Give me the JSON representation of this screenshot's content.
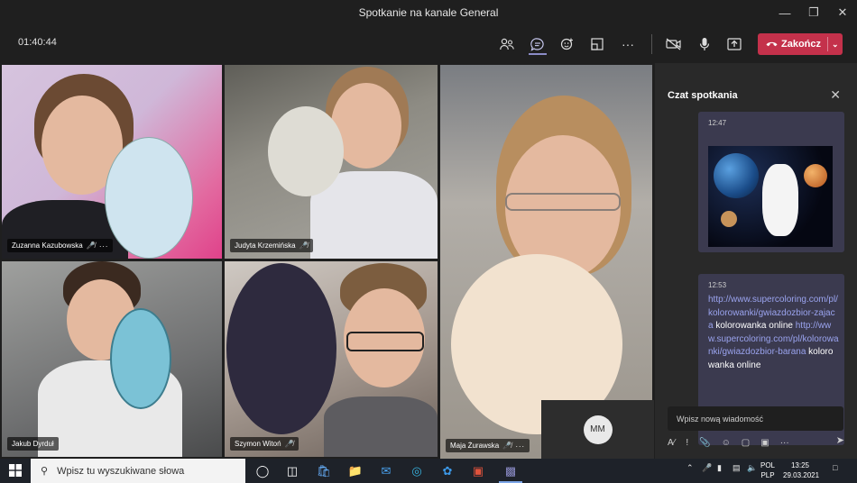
{
  "window": {
    "title": "Spotkanie na kanale General"
  },
  "toolbar": {
    "timer": "01:40:44",
    "end_label": "Zakończ",
    "icons": [
      "participants-icon",
      "chat-icon",
      "reactions-icon",
      "share-tray-icon",
      "more-icon",
      "camera-off-icon",
      "mic-icon",
      "share-screen-icon"
    ]
  },
  "participants": [
    {
      "name": "Zuzanna Kazubowska"
    },
    {
      "name": "Judyta Krzemińska"
    },
    {
      "name": "Maja Żurawska"
    },
    {
      "name": "Jakub Dyrduł"
    },
    {
      "name": "Szymon Witoń"
    }
  ],
  "self_avatar": {
    "initials": "MM"
  },
  "chat": {
    "title": "Czat spotkania",
    "messages": [
      {
        "time": "12:47"
      },
      {
        "time": "12:53",
        "link1": "http://www.supercoloring.com/pl/kolorowanki/gwiazdozbior-zajaca",
        "text1": " kolorowanka online",
        "link2": "http://www.supercoloring.com/pl/kolorowanki/gwiazdozbior-barana",
        "text2": " kolorowanka online"
      }
    ],
    "input_placeholder": "Wpisz nową wiadomość"
  },
  "taskbar": {
    "search_placeholder": "Wpisz tu wyszukiwane słowa",
    "lang_top": "POL",
    "lang_bottom": "PLP",
    "time": "13:25",
    "date": "29.03.2021"
  },
  "colors": {
    "end_button": "#c4314b",
    "link": "#9aa3ee",
    "accent": "#8b8cc7"
  }
}
